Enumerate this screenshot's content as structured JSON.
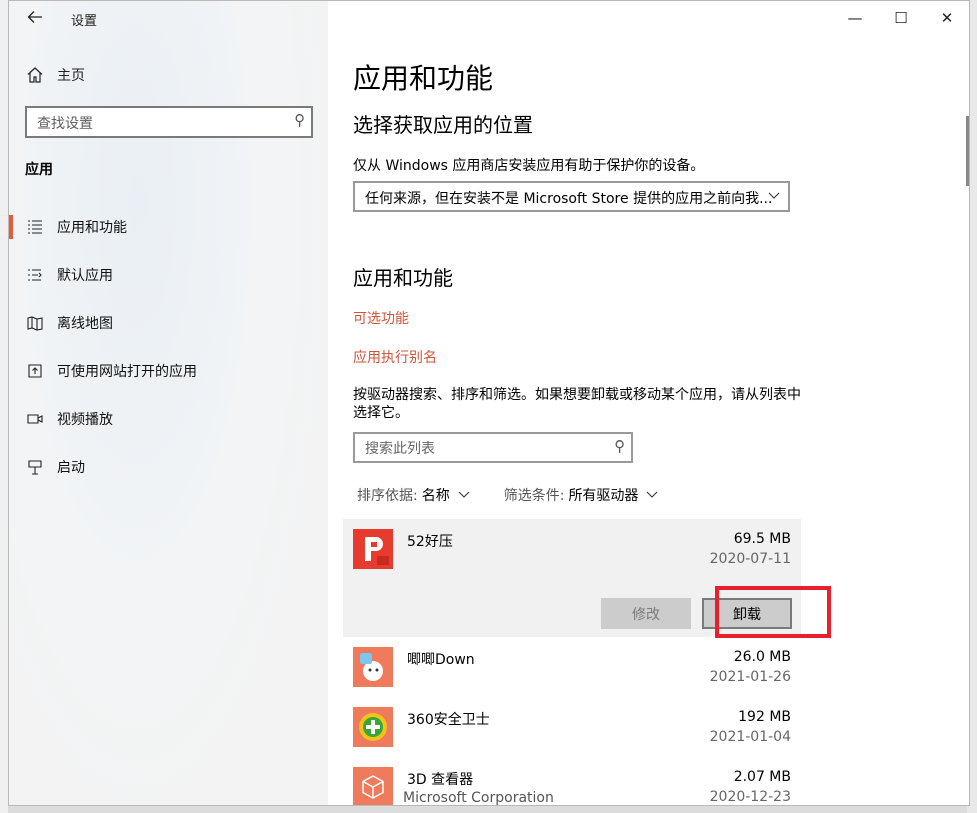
{
  "window": {
    "title": "设置",
    "controls": {
      "minimize": "—",
      "maximize": "☐",
      "close": "✕"
    }
  },
  "sidebar": {
    "home_label": "主页",
    "search_placeholder": "查找设置",
    "section": "应用",
    "items": [
      {
        "label": "应用和功能",
        "icon": "apps-list-icon",
        "active": true
      },
      {
        "label": "默认应用",
        "icon": "default-apps-icon",
        "active": false
      },
      {
        "label": "离线地图",
        "icon": "map-icon",
        "active": false
      },
      {
        "label": "可使用网站打开的应用",
        "icon": "open-in-app-icon",
        "active": false
      },
      {
        "label": "视频播放",
        "icon": "video-icon",
        "active": false
      },
      {
        "label": "启动",
        "icon": "startup-icon",
        "active": false
      }
    ]
  },
  "main": {
    "title": "应用和功能",
    "source_heading": "选择获取应用的位置",
    "source_desc": "仅从 Windows 应用商店安装应用有助于保护你的设备。",
    "source_value": "任何来源，但在安装不是 Microsoft Store 提供的应用之前向我...",
    "apps_heading": "应用和功能",
    "optional_features_link": "可选功能",
    "app_alias_link": "应用执行别名",
    "list_desc": "按驱动器搜索、排序和筛选。如果想要卸载或移动某个应用，请从列表中选择它。",
    "list_search_placeholder": "搜索此列表",
    "sort_key": "排序依据:",
    "sort_value": "名称",
    "filter_key": "筛选条件:",
    "filter_value": "所有驱动器",
    "modify_label": "修改",
    "uninstall_label": "卸载",
    "apps": [
      {
        "name": "52好压",
        "publisher": "",
        "size": "69.5 MB",
        "date": "2020-07-11",
        "icon": "haoya-icon"
      },
      {
        "name": "唧唧Down",
        "publisher": "",
        "size": "26.0 MB",
        "date": "2021-01-26",
        "icon": "jijidown-icon"
      },
      {
        "name": "360安全卫士",
        "publisher": "",
        "size": "192 MB",
        "date": "2021-01-04",
        "icon": "360-icon"
      },
      {
        "name": "3D 查看器",
        "publisher": "Microsoft Corporation",
        "size": "2.07 MB",
        "date": "2020-12-23",
        "icon": "3d-viewer-icon"
      }
    ]
  },
  "colors": {
    "accent": "#e15b3c",
    "link": "#d0563a",
    "highlight_box": "#e8202e"
  }
}
